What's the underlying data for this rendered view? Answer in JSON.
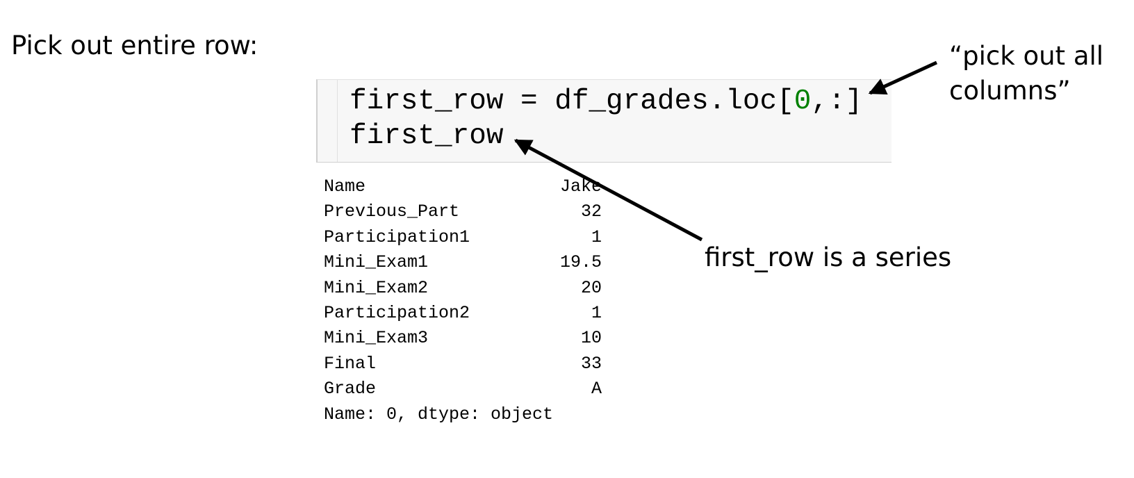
{
  "heading": "Pick out entire row:",
  "code": {
    "line1_prefix": "first_row = df_grades.loc[",
    "line1_number": "0",
    "line1_suffix": ",:]",
    "line2": "first_row"
  },
  "output": {
    "rows": [
      {
        "key": "Name",
        "value": "Jake"
      },
      {
        "key": "Previous_Part",
        "value": "32"
      },
      {
        "key": "Participation1",
        "value": "1"
      },
      {
        "key": "Mini_Exam1",
        "value": "19.5"
      },
      {
        "key": "Mini_Exam2",
        "value": "20"
      },
      {
        "key": "Participation2",
        "value": "1"
      },
      {
        "key": "Mini_Exam3",
        "value": "10"
      },
      {
        "key": "Final",
        "value": "33"
      },
      {
        "key": "Grade",
        "value": "A"
      }
    ],
    "footer": "Name: 0, dtype: object"
  },
  "annotations": {
    "columns_line1": "“pick out all",
    "columns_line2": "columns”",
    "series": "first_row is a series"
  },
  "colors": {
    "code_background": "#f7f7f7",
    "number_literal": "#008000",
    "arrow": "#000000"
  }
}
